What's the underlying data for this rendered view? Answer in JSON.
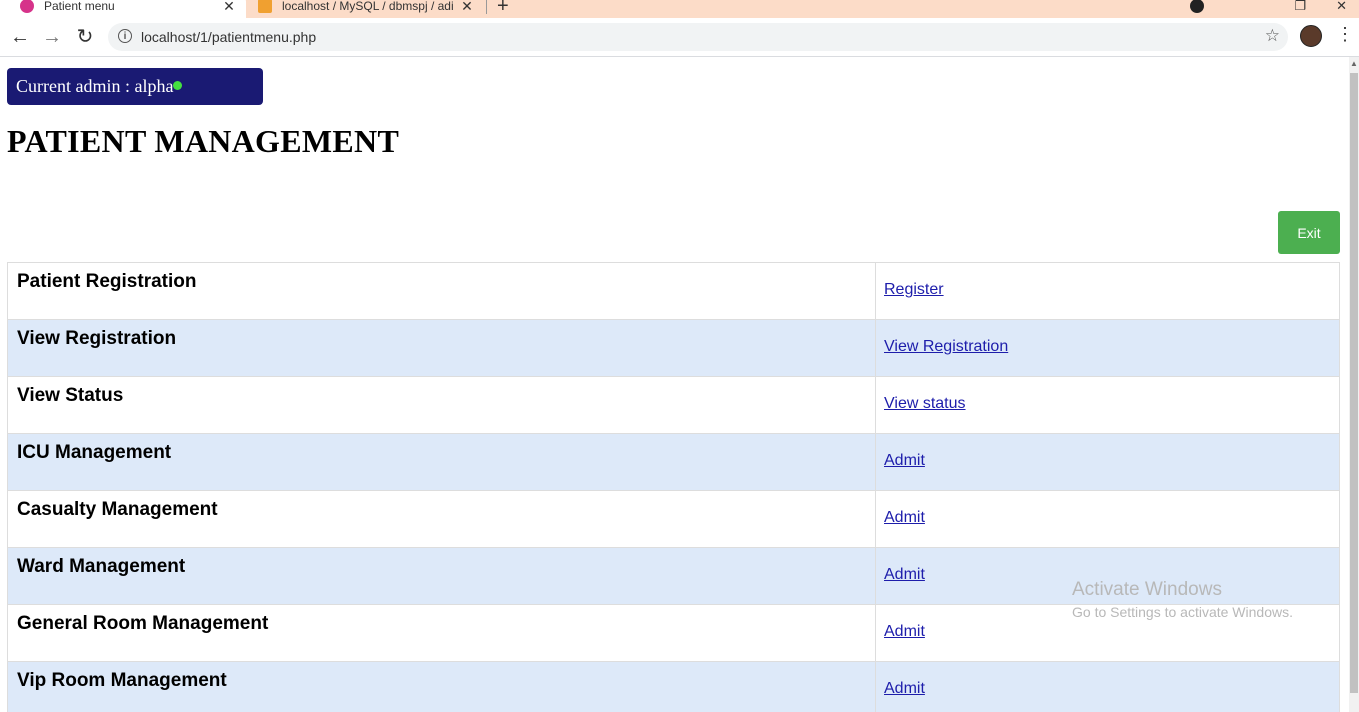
{
  "browser": {
    "tabs": [
      {
        "title": "Patient menu",
        "close": "✕"
      },
      {
        "title": "localhost / MySQL / dbmspj / adi",
        "close": "✕"
      }
    ],
    "new_tab": "+",
    "url": "localhost/1/patientmenu.php",
    "icons": {
      "back": "back-arrow-icon",
      "forward": "forward-arrow-icon",
      "reload": "reload-icon",
      "info": "info-icon",
      "star": "bookmark-star-icon",
      "menu": "kebab-menu-icon"
    }
  },
  "header": {
    "admin_label": "Current admin : alpha",
    "title": "PATIENT MANAGEMENT",
    "exit_label": "Exit"
  },
  "menu": [
    {
      "label": "Patient Registration",
      "action": "Register"
    },
    {
      "label": "View Registration",
      "action": "View Registration"
    },
    {
      "label": "View Status",
      "action": "View status"
    },
    {
      "label": "ICU Management",
      "action": "Admit"
    },
    {
      "label": "Casualty Management",
      "action": "Admit"
    },
    {
      "label": "Ward Management",
      "action": "Admit"
    },
    {
      "label": "General Room Management",
      "action": "Admit"
    },
    {
      "label": "Vip Room Management",
      "action": "Admit"
    }
  ],
  "watermark": {
    "title": "Activate Windows",
    "subtitle": "Go to Settings to activate Windows."
  },
  "colors": {
    "admin_badge": "#1a1a73",
    "online_dot": "#44e040",
    "exit_button": "#4caf50",
    "row_alt": "#dde9f9",
    "tab_strip": "#fcdcc8"
  }
}
